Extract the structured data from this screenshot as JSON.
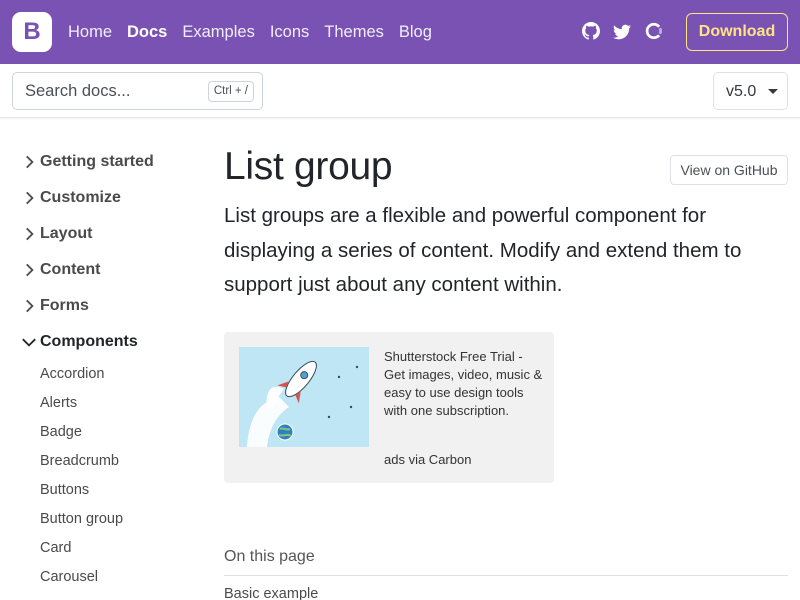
{
  "navbar": {
    "brand_letter": "B",
    "links": [
      "Home",
      "Docs",
      "Examples",
      "Icons",
      "Themes",
      "Blog"
    ],
    "active_link": "Docs",
    "icons": [
      "github-icon",
      "twitter-icon",
      "opencollective-icon"
    ],
    "download_label": "Download",
    "brand_color": "#7952b3",
    "accent_color": "#ffe484"
  },
  "search": {
    "placeholder": "Search docs...",
    "shortcut": "Ctrl + /"
  },
  "version": {
    "label": "v5.0"
  },
  "sidebar": {
    "sections": [
      {
        "label": "Getting started",
        "expanded": false
      },
      {
        "label": "Customize",
        "expanded": false
      },
      {
        "label": "Layout",
        "expanded": false
      },
      {
        "label": "Content",
        "expanded": false
      },
      {
        "label": "Forms",
        "expanded": false
      },
      {
        "label": "Components",
        "expanded": true
      }
    ],
    "component_items": [
      "Accordion",
      "Alerts",
      "Badge",
      "Breadcrumb",
      "Buttons",
      "Button group",
      "Card",
      "Carousel"
    ]
  },
  "main": {
    "title": "List group",
    "github_button": "View on GitHub",
    "lead": "List groups are a flexible and powerful component for displaying a series of content. Modify and extend them to support just about any content within."
  },
  "ad": {
    "text": "Shutterstock Free Trial - Get images, video, music & easy to use design tools with one subscription.",
    "via": "ads via Carbon"
  },
  "toc": {
    "title": "On this page",
    "items": [
      "Basic example"
    ]
  }
}
